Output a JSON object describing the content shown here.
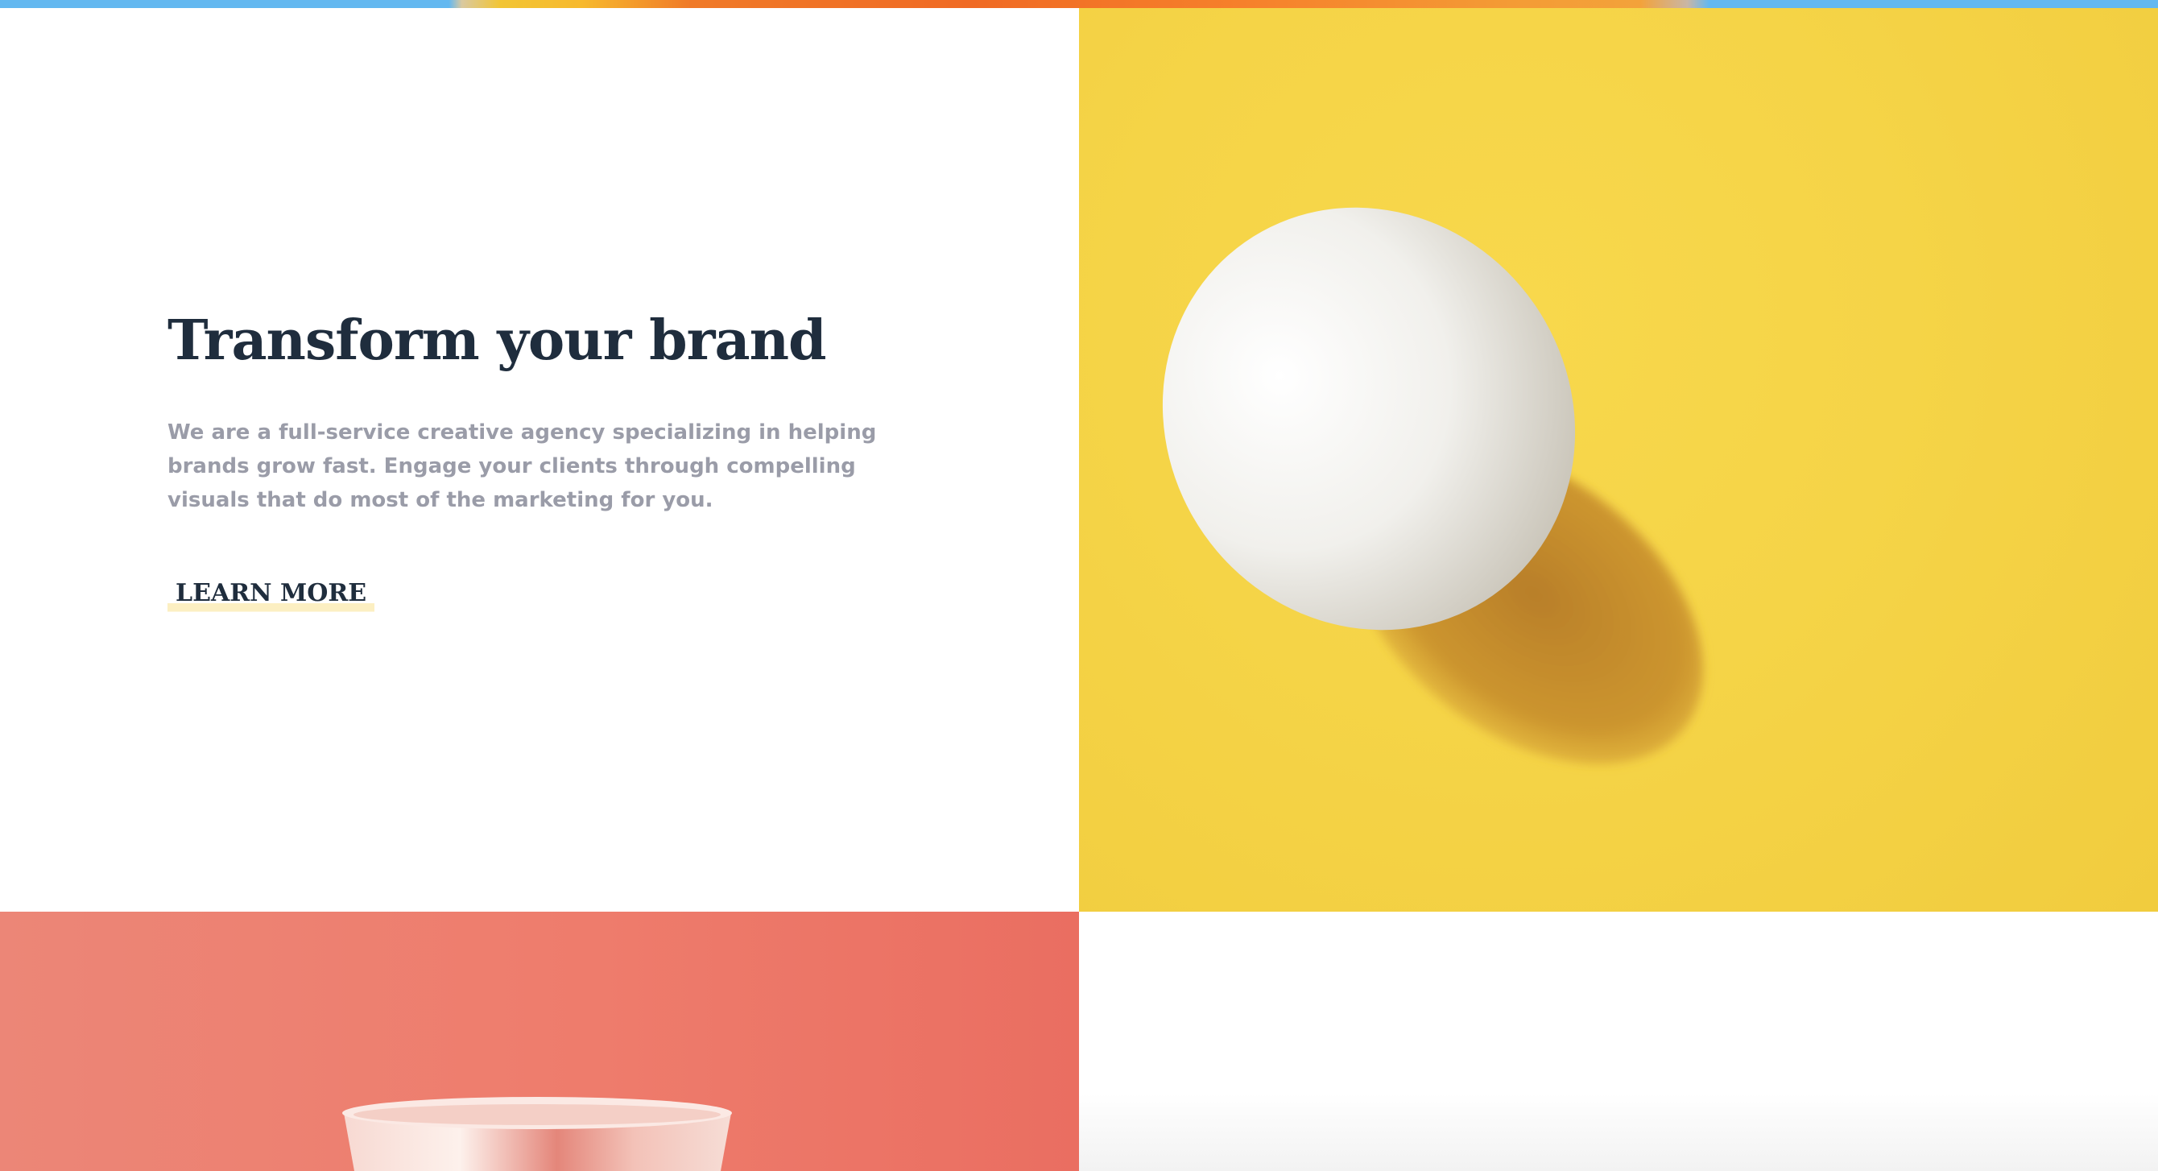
{
  "hero": {
    "title": "Transform your brand",
    "description": "We are a full-service creative agency specializing in helping brands grow fast. Engage your clients through compelling visuals that do most of the marketing for you.",
    "cta_label": "LEARN MORE"
  },
  "colors": {
    "heading": "#1f2d3d",
    "body_text": "#9a9ca8",
    "accent_yellow": "#f5d447",
    "accent_coral": "#ee7c6c",
    "underline_highlight": "#fcefc2",
    "top_strip_blue": "#63b8f0"
  },
  "images": {
    "top_strip": "colorful-banner-image",
    "yellow_panel": "egg-photo",
    "coral_panel": "cup-photo"
  }
}
